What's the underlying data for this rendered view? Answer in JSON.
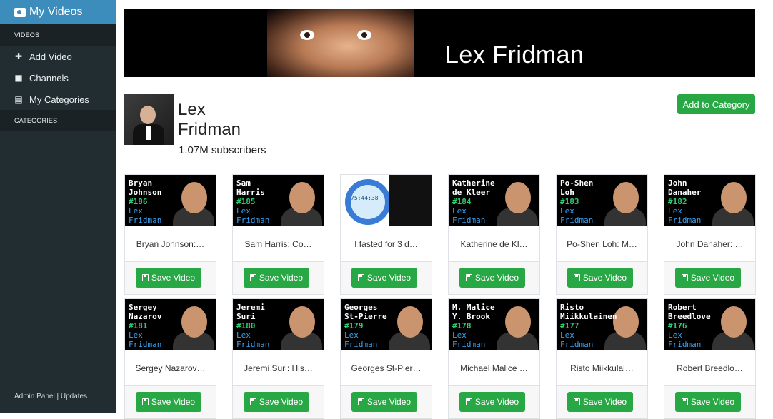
{
  "sidebar": {
    "brand": "My Videos",
    "sections": {
      "videos_header": "VIDEOS",
      "categories_header": "CATEGORIES"
    },
    "items": [
      {
        "label": "Add Video",
        "icon": "plus-icon"
      },
      {
        "label": "Channels",
        "icon": "youtube-icon"
      },
      {
        "label": "My Categories",
        "icon": "book-icon"
      }
    ],
    "footer": {
      "admin": "Admin Panel",
      "sep": "|",
      "updates": "Updates"
    }
  },
  "channel": {
    "banner_title": "Lex Fridman",
    "name_line1": "Lex",
    "name_line2": "Fridman",
    "subscribers": "1.07M subscribers",
    "add_to_category_label": "Add to Category"
  },
  "videos": [
    {
      "thumb_name": [
        "Bryan",
        "Johnson"
      ],
      "episode": "#186",
      "host": [
        "Lex",
        "Fridman"
      ],
      "title": "Bryan Johnson:…",
      "save_label": "Save Video"
    },
    {
      "thumb_name": [
        "Sam",
        "Harris"
      ],
      "episode": "#185",
      "host": [
        "Lex",
        "Fridman"
      ],
      "title": "Sam Harris: Co…",
      "save_label": "Save Video"
    },
    {
      "thumb_name": [],
      "episode": "",
      "host": [],
      "title": "I fasted for 3 d…",
      "watch_time": "75:44:38",
      "save_label": "Save Video"
    },
    {
      "thumb_name": [
        "Katherine",
        "de Kleer"
      ],
      "episode": "#184",
      "host": [
        "Lex",
        "Fridman"
      ],
      "title": "Katherine de Kl…",
      "save_label": "Save Video"
    },
    {
      "thumb_name": [
        "Po-Shen",
        "Loh"
      ],
      "episode": "#183",
      "host": [
        "Lex",
        "Fridman"
      ],
      "title": "Po-Shen Loh: M…",
      "save_label": "Save Video"
    },
    {
      "thumb_name": [
        "John",
        "Danaher"
      ],
      "episode": "#182",
      "host": [
        "Lex",
        "Fridman"
      ],
      "title": "John Danaher: …",
      "save_label": "Save Video"
    },
    {
      "thumb_name": [
        "Sergey",
        "Nazarov"
      ],
      "episode": "#181",
      "host": [
        "Lex",
        "Fridman"
      ],
      "title": "Sergey Nazarov…",
      "save_label": "Save Video"
    },
    {
      "thumb_name": [
        "Jeremi",
        "Suri"
      ],
      "episode": "#180",
      "host": [
        "Lex",
        "Fridman"
      ],
      "title": "Jeremi Suri: His…",
      "save_label": "Save Video"
    },
    {
      "thumb_name": [
        "Georges",
        "St-Pierre"
      ],
      "episode": "#179",
      "host": [
        "Lex",
        "Fridman"
      ],
      "title": "Georges St-Pier…",
      "save_label": "Save Video"
    },
    {
      "thumb_name": [
        "M. Malice",
        "Y. Brook"
      ],
      "episode": "#178",
      "host": [
        "Lex",
        "Fridman"
      ],
      "title": "Michael Malice …",
      "save_label": "Save Video"
    },
    {
      "thumb_name": [
        "Risto",
        "Miikkulainen"
      ],
      "episode": "#177",
      "host": [
        "Lex",
        "Fridman"
      ],
      "title": "Risto Miikkulai…",
      "save_label": "Save Video"
    },
    {
      "thumb_name": [
        "Robert",
        "Breedlove"
      ],
      "episode": "#176",
      "host": [
        "Lex",
        "Fridman"
      ],
      "title": "Robert Breedlo…",
      "save_label": "Save Video"
    }
  ],
  "colors": {
    "sidebar_bg": "#222d32",
    "brand_bg": "#3c8dbc",
    "button_green": "#28a745",
    "episode_green": "#2ecc71",
    "host_blue": "#3aa0f0"
  }
}
